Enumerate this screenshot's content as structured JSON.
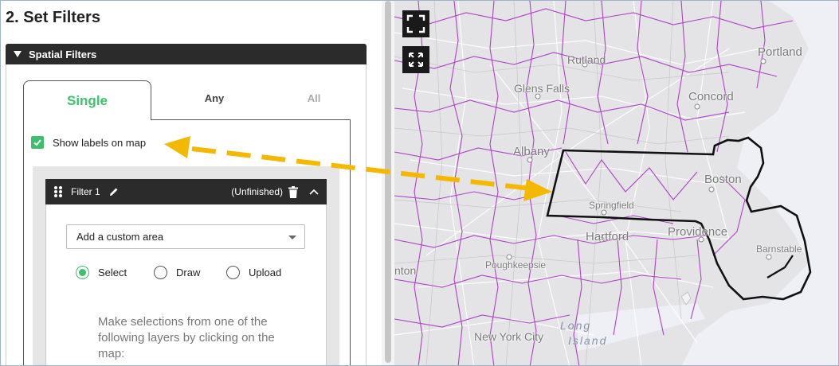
{
  "page": {
    "title": "2. Set Filters"
  },
  "spatial_filters": {
    "header": "Spatial Filters",
    "tabs": [
      {
        "label": "Single",
        "state": "active"
      },
      {
        "label": "Any",
        "state": "inactive"
      },
      {
        "label": "All",
        "state": "disabled"
      }
    ],
    "show_labels": {
      "label": "Show labels on map",
      "checked": true
    }
  },
  "filter": {
    "name": "Filter 1",
    "status": "(Unfinished)",
    "icons": [
      "drag-handle-icon",
      "pencil-icon",
      "trash-icon",
      "chevron-up-icon"
    ],
    "area_select": {
      "value": "Add a custom area"
    },
    "modes": [
      {
        "label": "Select",
        "checked": true
      },
      {
        "label": "Draw",
        "checked": false
      },
      {
        "label": "Upload",
        "checked": false
      }
    ],
    "instructions": "Make selections from one of the following layers by clicking on the map:"
  },
  "map": {
    "buttons": [
      "fullscreen-icon",
      "expand-icon"
    ],
    "labels": [
      {
        "text": "Rutland",
        "kind": "city"
      },
      {
        "text": "Portland",
        "kind": "city"
      },
      {
        "text": "Glens Falls",
        "kind": "city"
      },
      {
        "text": "Concord",
        "kind": "city"
      },
      {
        "text": "Albany",
        "kind": "city"
      },
      {
        "text": "Boston",
        "kind": "city"
      },
      {
        "text": "Springfield",
        "kind": "city"
      },
      {
        "text": "Hartford",
        "kind": "city"
      },
      {
        "text": "Providence",
        "kind": "city"
      },
      {
        "text": "Poughkeepsie",
        "kind": "city"
      },
      {
        "text": "Barnstable",
        "kind": "city"
      },
      {
        "text": "nton",
        "kind": "city"
      },
      {
        "text": "New York City",
        "kind": "city"
      },
      {
        "text": "Long",
        "kind": "water"
      },
      {
        "text": "Island",
        "kind": "water"
      }
    ]
  },
  "colors": {
    "accent_green": "#3dbf6e",
    "header_dark": "#2b2b2b",
    "annotation_arrow": "#f5b800",
    "boundary_purple": "#b040c8"
  }
}
